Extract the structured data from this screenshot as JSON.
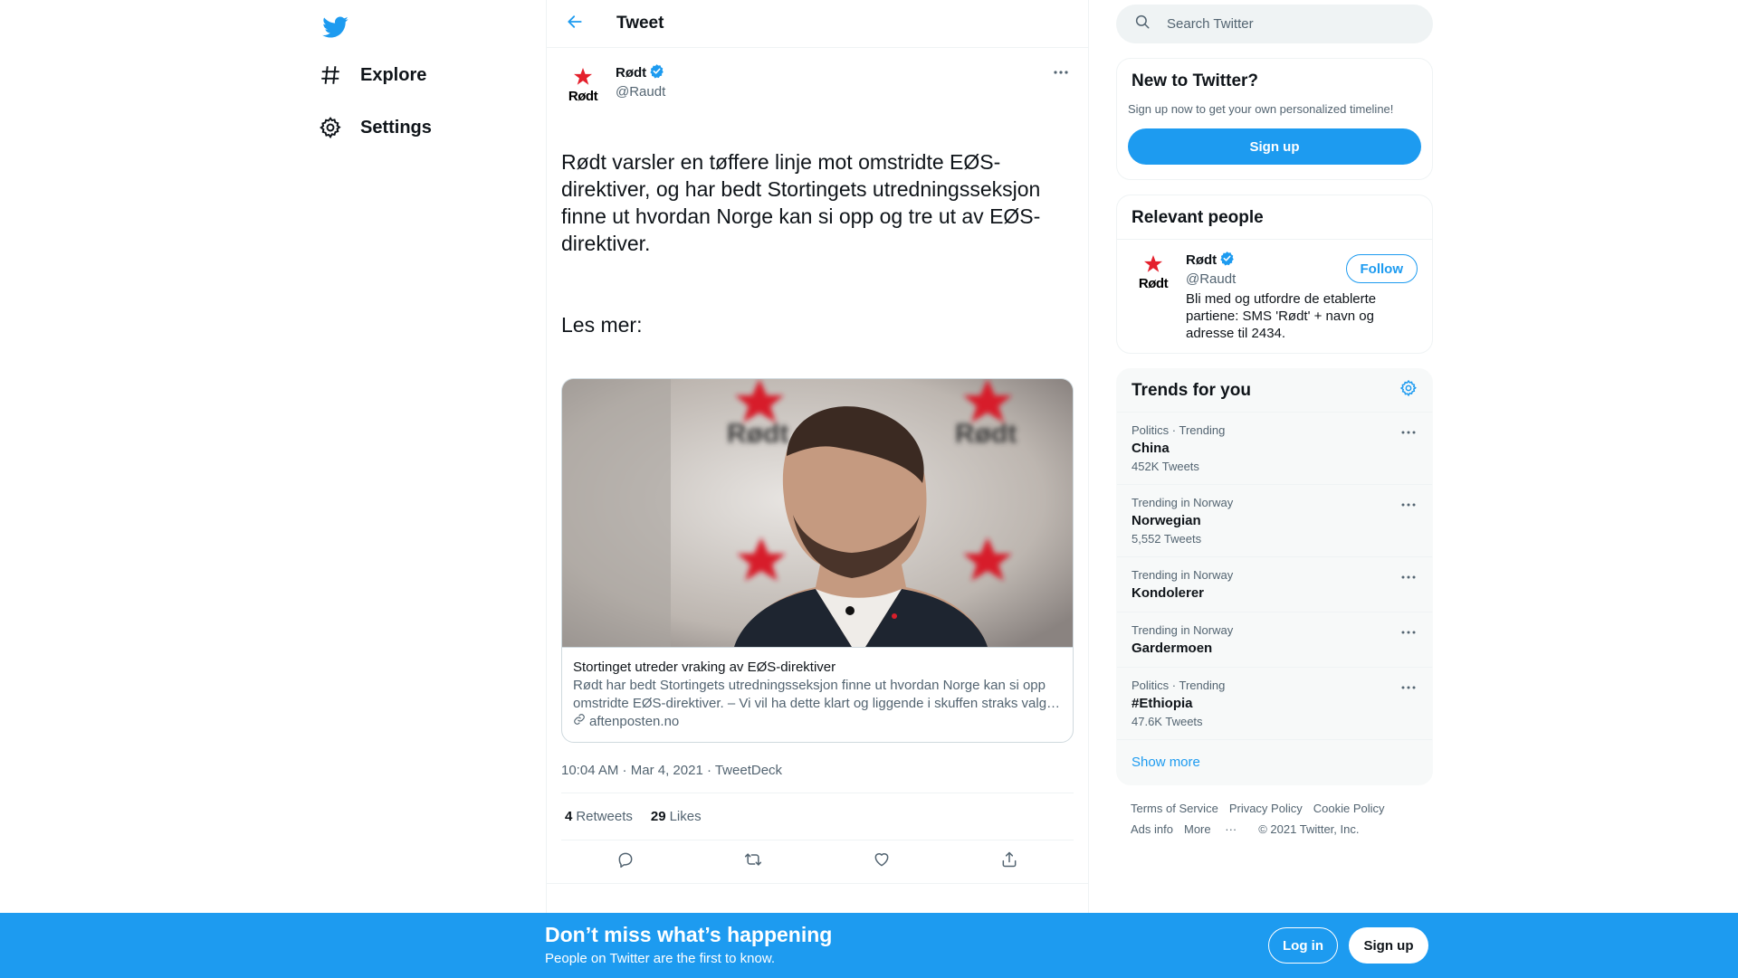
{
  "nav": {
    "explore_label": "Explore",
    "settings_label": "Settings"
  },
  "header": {
    "title": "Tweet"
  },
  "tweet": {
    "author_name": "Rødt",
    "author_handle": "@Raudt",
    "avatar_text": "Rødt",
    "text_p1": "Rødt varsler en tøffere linje mot omstridte EØS-direktiver, og har bedt Stortingets utredningsseksjon finne ut hvordan Norge kan si opp og tre ut av EØS-direktiver.",
    "text_p2": "Les mer:",
    "card": {
      "title": "Stortinget utreder vraking av EØS-direktiver",
      "description": "Rødt har bedt Stortingets utredningsseksjon finne ut hvordan Norge kan si opp omstridte EØS-direktiver. – Vi vil ha dette klart og liggende i skuffen straks valg…",
      "domain": "aftenposten.no",
      "image_logo_text": "Rødt"
    },
    "time": "10:04 AM",
    "date": "Mar 4, 2021",
    "source": "TweetDeck",
    "retweets_count": "4",
    "retweets_label": "Retweets",
    "likes_count": "29",
    "likes_label": "Likes"
  },
  "search": {
    "placeholder": "Search Twitter"
  },
  "new_to_twitter": {
    "title": "New to Twitter?",
    "text": "Sign up now to get your own personalized timeline!",
    "button": "Sign up"
  },
  "relevant_people": {
    "title": "Relevant people",
    "person": {
      "name": "Rødt",
      "handle": "@Raudt",
      "avatar_text": "Rødt",
      "bio": "Bli med og utfordre de etablerte partiene: SMS 'Rødt' + navn og adresse til 2434.",
      "follow_label": "Follow"
    }
  },
  "trends": {
    "title": "Trends for you",
    "items": [
      {
        "context": "Politics · Trending",
        "name": "China",
        "count": "452K Tweets"
      },
      {
        "context": "Trending in Norway",
        "name": "Norwegian",
        "count": "5,552 Tweets"
      },
      {
        "context": "Trending in Norway",
        "name": "Kondolerer",
        "count": ""
      },
      {
        "context": "Trending in Norway",
        "name": "Gardermoen",
        "count": ""
      },
      {
        "context": "Politics · Trending",
        "name": "#Ethiopia",
        "count": "47.6K Tweets"
      }
    ],
    "show_more": "Show more"
  },
  "footer": {
    "terms": "Terms of Service",
    "privacy": "Privacy Policy",
    "cookie": "Cookie Policy",
    "ads": "Ads info",
    "more": "More",
    "more_icon": "···",
    "copyright": "© 2021 Twitter, Inc."
  },
  "bottom_bar": {
    "title": "Don’t miss what’s happening",
    "subtitle": "People on Twitter are the first to know.",
    "login": "Log in",
    "signup": "Sign up"
  },
  "colors": {
    "brand": "#1d9bf0",
    "rodt_red": "#e4202c",
    "text": "#0f1419",
    "secondary": "#536471"
  },
  "icons": [
    "twitter-logo-icon",
    "hashtag-icon",
    "gear-icon",
    "back-arrow-icon",
    "verified-icon",
    "more-icon",
    "link-icon",
    "reply-icon",
    "retweet-icon",
    "like-icon",
    "share-icon",
    "search-icon"
  ]
}
